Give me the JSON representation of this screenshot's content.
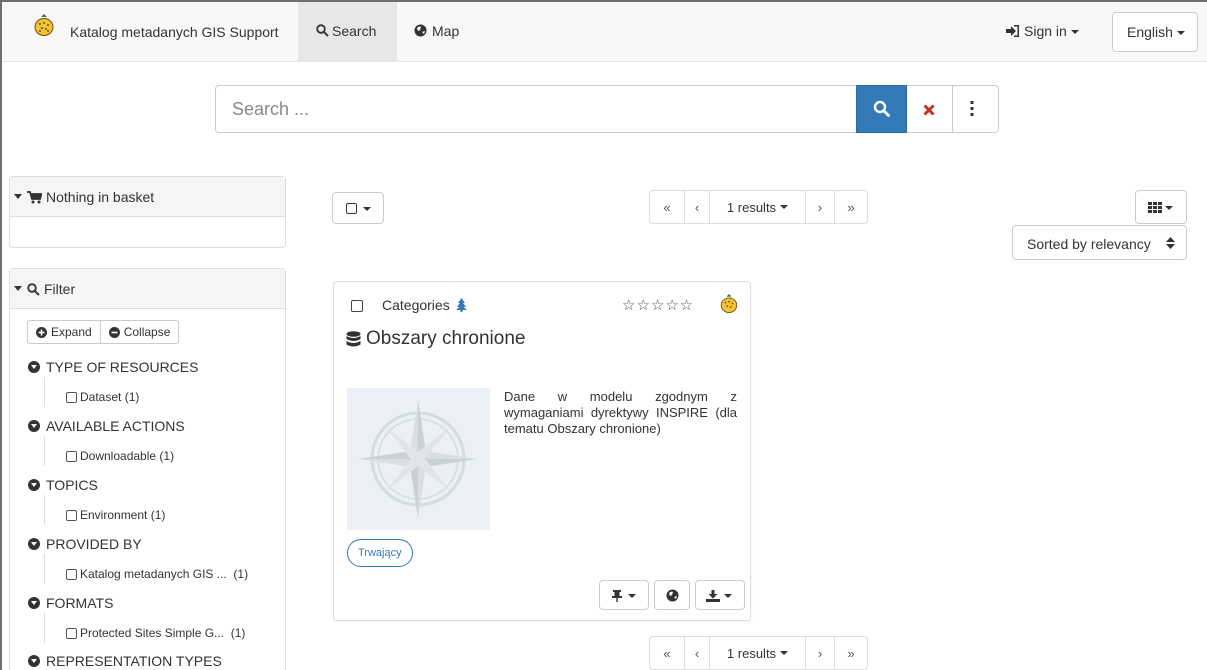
{
  "navbar": {
    "brand": "Katalog metadanych GIS Support",
    "search_tab": "Search",
    "map_tab": "Map",
    "signin": "Sign in",
    "language": "English"
  },
  "search": {
    "placeholder": "Search ..."
  },
  "basket": {
    "label": "Nothing in basket"
  },
  "filter": {
    "label": "Filter",
    "expand": "Expand",
    "collapse": "Collapse",
    "facets": [
      {
        "title": "TYPE OF RESOURCES",
        "item": "Dataset",
        "count": "(1)"
      },
      {
        "title": "AVAILABLE ACTIONS",
        "item": "Downloadable",
        "count": "(1)"
      },
      {
        "title": "TOPICS",
        "item": "Environment",
        "count": "(1)"
      },
      {
        "title": "PROVIDED BY",
        "item": "Katalog metadanych GIS ...",
        "count": "(1)"
      },
      {
        "title": "FORMATS",
        "item": "Protected Sites Simple G...",
        "count": "(1)"
      },
      {
        "title": "REPRESENTATION TYPES"
      }
    ]
  },
  "results": {
    "pager_label": "1 results",
    "sort_label": "Sorted by relevancy"
  },
  "card": {
    "category_label": "Categories",
    "title": "Obszary chronione",
    "abstract": "Dane w modelu zgodnym z wymaganiami dyrektywy INSPIRE (dla tematu Obszary chronione)",
    "status": "Trwający",
    "rating_stars": 0,
    "rating_max": 5
  },
  "colors": {
    "primary": "#337ab7",
    "danger": "#c9302c",
    "category_icon": "#337ab7"
  }
}
